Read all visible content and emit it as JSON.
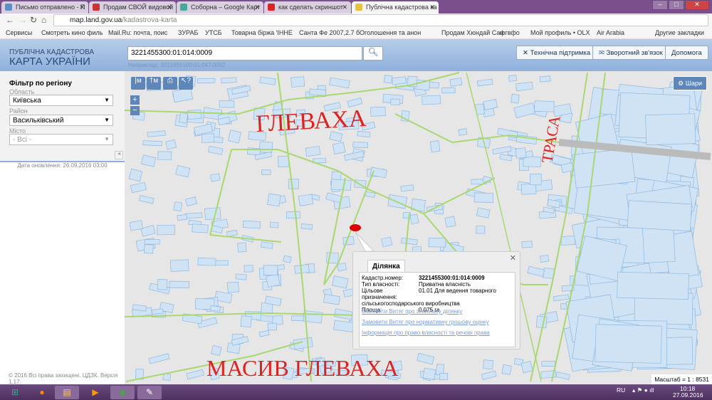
{
  "browser": {
    "tabs": [
      {
        "label": "Письмо отправлено - П",
        "color": "#5a8fc8"
      },
      {
        "label": "Продам СВОЙ видовой",
        "color": "#c33"
      },
      {
        "label": "Соборна – Google Карт",
        "color": "#4a9"
      },
      {
        "label": "как сделать скриншот",
        "color": "#d22"
      },
      {
        "label": "Публічна кадастрова ка",
        "color": "#e8c23a",
        "active": true
      }
    ],
    "url_host": "map.land.gov.ua",
    "url_path": "/kadastrova-karta",
    "bookmarks": [
      "Сервисы",
      "Смотреть кино филь",
      "Mail.Ru: почта, поис",
      "ЗУРАБ",
      "УТСБ",
      "Товарна біржа 'ІННЕ",
      "Санта Фе 2007,2.7 б",
      "Оголошення та анон",
      "Продам Хюндай Сан",
      "фгвфо",
      "Мой профиль • OLX",
      "Air Arabia",
      "Другие закладки"
    ]
  },
  "header": {
    "logo_line1": "ПУБЛІЧНА КАДАСТРОВА",
    "logo_line2": "КАРТА УКРАЇНИ",
    "search_value": "3221455300:01:014:0009",
    "search_hint": "Наприклад: 3221655100:01:047:0052",
    "support": "Технічна підтримка",
    "feedback": "Зворотний зв'язок",
    "help": "Допомога"
  },
  "sidebar": {
    "title": "Фільтр по регіону",
    "oblast_label": "Область",
    "oblast": "Київська",
    "raion_label": "Район",
    "raion": "Васильківський",
    "misto_label": "Місто",
    "misto": "- Всі -",
    "updated": "Дата оновлення: 26.09.2016 03:00",
    "copyright": "© 2016 Всі права захищені. ЦДЗК. Версія 1.17."
  },
  "map": {
    "layers": "Шари",
    "tools": [
      "|м",
      "†м",
      "print",
      "?"
    ],
    "scale": "Масштаб = 1 : 8531",
    "annotations": {
      "top": "ГЛЕВАХА",
      "right": "ТРАСА",
      "bottom": "МАСИВ ГЛЕВАХА"
    },
    "popup": {
      "tab": "Ділянка",
      "rows": [
        {
          "k": "Кадастр.номер:",
          "v": "3221455300:01:014:0009"
        },
        {
          "k": "Тип власності:",
          "v": "Приватна власність"
        },
        {
          "k": "Цільове призначення:",
          "v": "01.01 Для ведення товарного"
        }
      ],
      "purpose_cont": "сільськогосподарського виробництва",
      "area_k": "Площа:",
      "area_v": "0.075 га",
      "links": [
        "Замовити Витяг про земельну ділянку",
        "Замовити Витяг про нормативну грошову оцінку",
        "Інформація про право власності та речові права"
      ]
    }
  },
  "taskbar": {
    "lang": "RU",
    "time": "10:18",
    "date": "27.09.2016"
  }
}
